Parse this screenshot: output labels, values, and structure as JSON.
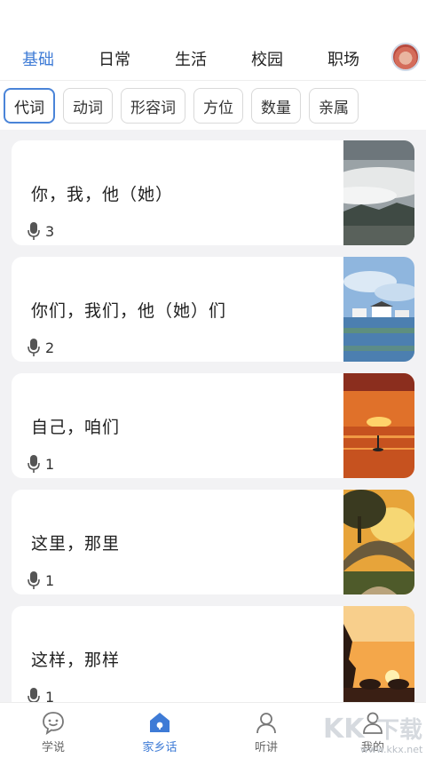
{
  "top_tabs": [
    "基础",
    "日常",
    "生活",
    "校园",
    "职场"
  ],
  "active_top_tab": 0,
  "sub_tabs": [
    "代词",
    "动词",
    "形容词",
    "方位",
    "数量",
    "亲属"
  ],
  "active_sub_tab": 0,
  "cards": [
    {
      "title": "你，我，他（她）",
      "count": "3"
    },
    {
      "title": "你们，我们，他（她）们",
      "count": "2"
    },
    {
      "title": "自己，咱们",
      "count": "1"
    },
    {
      "title": "这里，那里",
      "count": "1"
    },
    {
      "title": "这样，那样",
      "count": "1"
    }
  ],
  "bottom_nav": [
    "学说",
    "家乡话",
    "听讲",
    "我的"
  ],
  "active_nav": 1,
  "watermark": {
    "text": "KK下载",
    "url": "www.kkx.net"
  },
  "colors": {
    "accent": "#3e7bd6",
    "background": "#f2f2f4"
  }
}
